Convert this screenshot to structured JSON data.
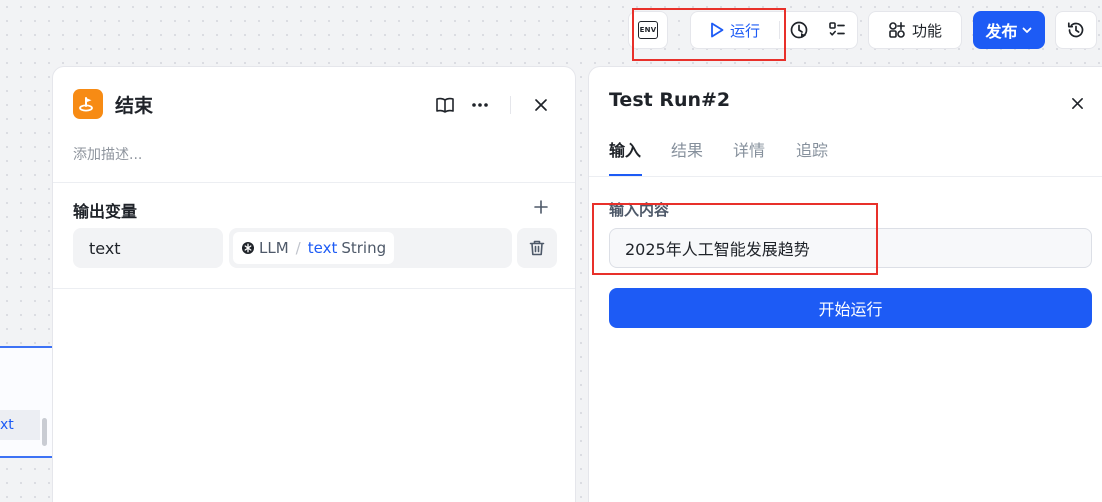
{
  "toolbar": {
    "env_label": "ENV",
    "run_label": "运行",
    "features_label": "功能",
    "publish_label": "发布"
  },
  "canvas": {
    "node_row_text": "xt"
  },
  "end_node": {
    "title": "结束",
    "description_placeholder": "添加描述...",
    "output_section_title": "输出变量",
    "variables": [
      {
        "name": "text",
        "source_node": "LLM",
        "source_var": "text",
        "type": "String"
      }
    ]
  },
  "test_run": {
    "title": "Test Run#2",
    "tabs": [
      "输入",
      "结果",
      "详情",
      "追踪"
    ],
    "active_tab": "输入",
    "input_label": "输入内容",
    "input_value": "2025年人工智能发展趋势",
    "start_button_label": "开始运行"
  },
  "colors": {
    "primary": "#1d5bf5",
    "end_node_icon": "#f78b14",
    "annotation": "#e8302a"
  }
}
